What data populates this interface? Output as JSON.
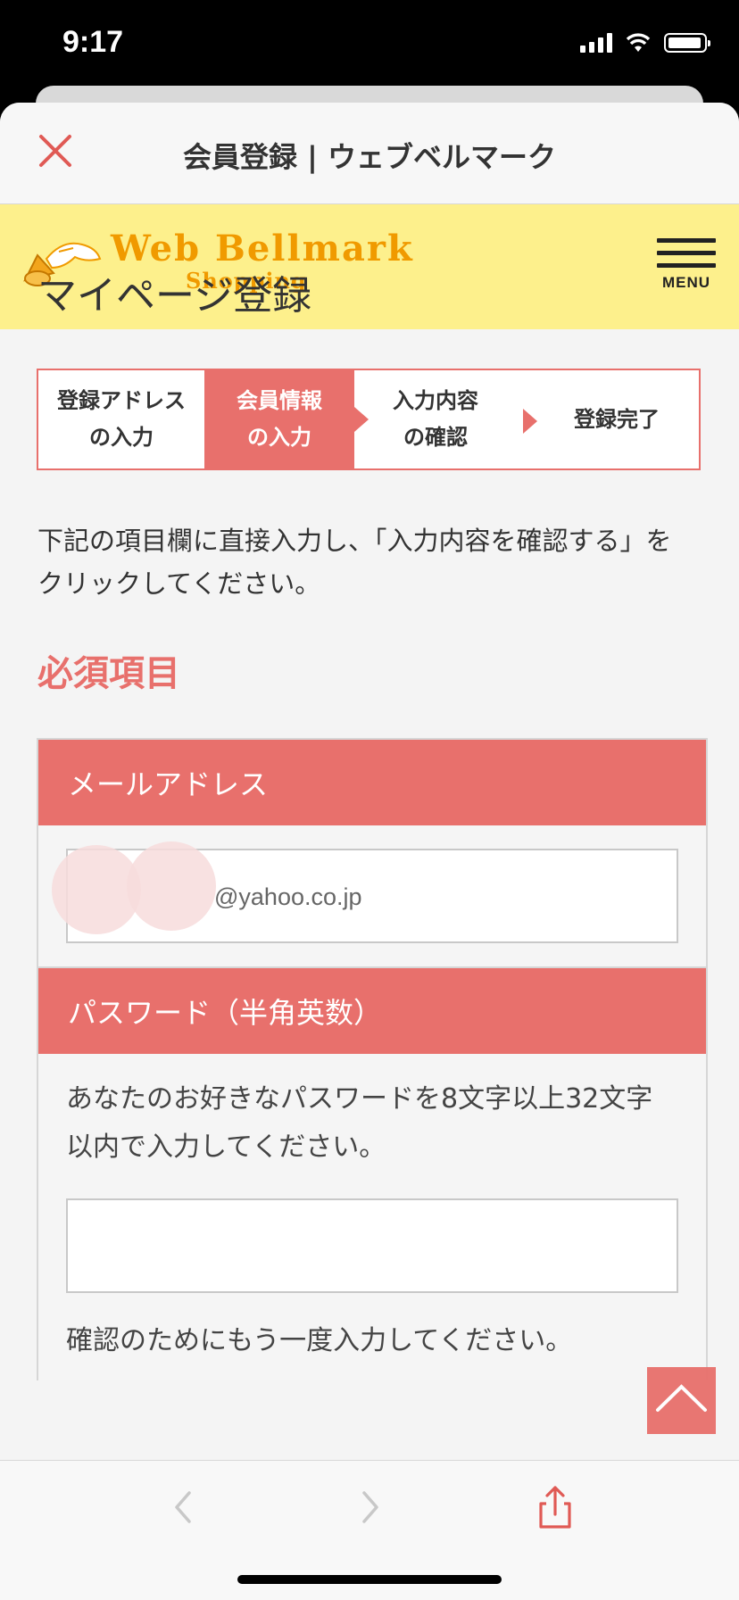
{
  "status_bar": {
    "time": "9:17"
  },
  "sheet": {
    "title": "会員登録 | ウェブベルマーク"
  },
  "site": {
    "logo_main": "Web Bellmark",
    "logo_sub": "Shopping",
    "menu_label": "MENU"
  },
  "page": {
    "title": "マイページ登録",
    "steps": [
      {
        "line1": "登録アドレス",
        "line2": "の入力"
      },
      {
        "line1": "会員情報",
        "line2": "の入力"
      },
      {
        "line1": "入力内容",
        "line2": "の確認"
      },
      {
        "line1": "登録完了",
        "line2": ""
      }
    ],
    "instructions": "下記の項目欄に直接入力し、「入力内容を確認する」をクリックしてください。",
    "required_heading": "必須項目"
  },
  "form": {
    "email_label": "メールアドレス",
    "email_value": "@yahoo.co.jp",
    "password_label": "パスワード（半角英数）",
    "password_help": "あなたのお好きなパスワードを8文字以上32文字以内で入力してください。",
    "password_confirm_help": "確認のためにもう一度入力してください。"
  },
  "colors": {
    "accent": "#e8706c",
    "header_bg": "#fdf08c",
    "logo": "#f09a00"
  }
}
